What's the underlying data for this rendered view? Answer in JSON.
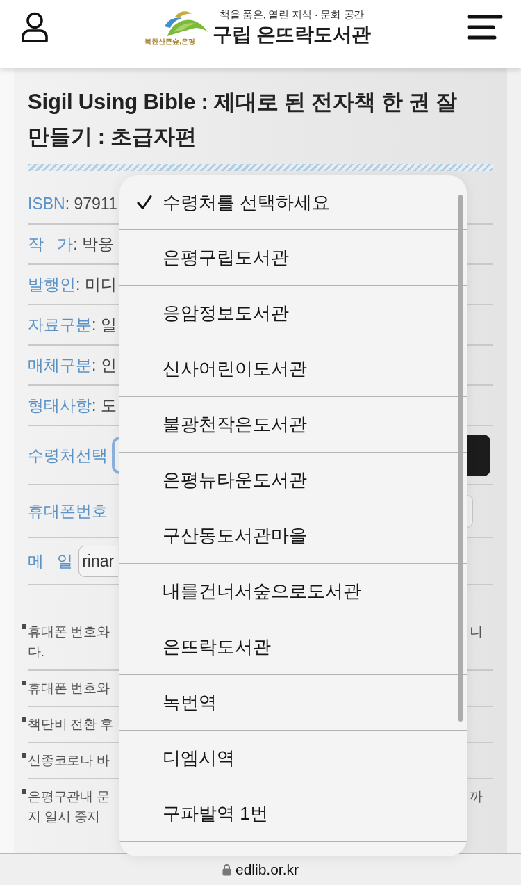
{
  "header": {
    "logo_text": "북한산큰숲,은평",
    "tagline": "책을 품은, 열린 지식 · 문화 공간",
    "title": "구립 은뜨락도서관"
  },
  "book": {
    "title": "Sigil Using Bible : 제대로 된 전자책 한 권 잘 만들기 : 초급자편"
  },
  "fields": [
    {
      "kind": "text",
      "label": "ISBN",
      "value": ": 97911"
    },
    {
      "kind": "text",
      "label": "작   가",
      "value": ": 박웅"
    },
    {
      "kind": "text",
      "label": "발행인",
      "value": ": 미디"
    },
    {
      "kind": "text",
      "label": "자료구분",
      "value": ": 일"
    },
    {
      "kind": "text",
      "label": "매체구분",
      "value": ": 인"
    },
    {
      "kind": "text",
      "label": "형태사항",
      "value": ": 도"
    },
    {
      "kind": "select",
      "label": "수령처선택",
      "focused": true
    },
    {
      "kind": "phone",
      "label": "휴대폰번호"
    },
    {
      "kind": "email",
      "label": "메   일",
      "value": "rinar"
    }
  ],
  "notes": [
    {
      "lines": [
        "휴대폰 번호와",
        "다."
      ],
      "right_text": "니"
    },
    {
      "lines": [
        "휴대폰 번호와"
      ]
    },
    {
      "lines": [
        "책단비 전환 후"
      ]
    },
    {
      "lines": [
        "신종코로나 바"
      ]
    },
    {
      "lines": [
        "은평구관내 문",
        "지 일시 중지"
      ],
      "right_text": "까"
    }
  ],
  "pickup_menu": {
    "options": [
      {
        "label": "수령처를 선택하세요",
        "selected": true
      },
      {
        "label": "은평구립도서관",
        "selected": false
      },
      {
        "label": "응암정보도서관",
        "selected": false
      },
      {
        "label": "신사어린이도서관",
        "selected": false
      },
      {
        "label": "불광천작은도서관",
        "selected": false
      },
      {
        "label": "은평뉴타운도서관",
        "selected": false
      },
      {
        "label": "구산동도서관마을",
        "selected": false
      },
      {
        "label": "내를건너서숲으로도서관",
        "selected": false
      },
      {
        "label": "은뜨락도서관",
        "selected": false
      },
      {
        "label": "녹번역",
        "selected": false
      },
      {
        "label": "디엠시역",
        "selected": false
      },
      {
        "label": "구파발역 1번",
        "selected": false
      }
    ]
  },
  "browser_bar": {
    "url": "edlib.or.kr"
  }
}
